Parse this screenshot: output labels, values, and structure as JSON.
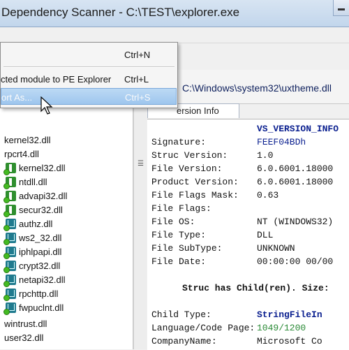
{
  "window": {
    "title": "Dependency Scanner - C:\\TEST\\explorer.exe"
  },
  "context_menu": {
    "items": [
      {
        "label": "",
        "shortcut": "Ctrl+N"
      },
      {
        "label": "cted module to PE Explorer",
        "shortcut": "Ctrl+L"
      },
      {
        "label": "ort As...",
        "shortcut": "Ctrl+S"
      }
    ]
  },
  "path_bar": {
    "path": "C:\\Windows\\system32\\uxtheme.dll"
  },
  "tab": {
    "label": "ersion Info"
  },
  "version_info": {
    "rows": [
      {
        "label": "",
        "value": "VS_VERSION_INFO"
      },
      {
        "label": "Signature:",
        "value": "FEEF04BDh"
      },
      {
        "label": "Struc Version:",
        "value": "1.0"
      },
      {
        "label": "File Version:",
        "value": "6.0.6001.18000"
      },
      {
        "label": "Product Version:",
        "value": "6.0.6001.18000"
      },
      {
        "label": "File Flags Mask:",
        "value": "0.63"
      },
      {
        "label": "File Flags:",
        "value": ""
      },
      {
        "label": "File OS:",
        "value": "NT (WINDOWS32)"
      },
      {
        "label": "File Type:",
        "value": "DLL"
      },
      {
        "label": "File SubType:",
        "value": "UNKNOWN"
      },
      {
        "label": "File Date:",
        "value": "00:00:00  00/00"
      }
    ],
    "struc_note": "Struc has Child(ren). Size:",
    "child_rows": [
      {
        "label": "Child Type:",
        "value": "StringFileIn"
      },
      {
        "label": "Language/Code Page:",
        "value": "1049/1200"
      },
      {
        "label": "CompanyName:",
        "value": "Microsoft Co"
      }
    ]
  },
  "tree": {
    "items": [
      {
        "label": "kernel32.dll",
        "icon": "none"
      },
      {
        "label": "rpcrt4.dll",
        "icon": "none"
      },
      {
        "label": "kernel32.dll",
        "icon": "green-dll-icon"
      },
      {
        "label": "ntdll.dll",
        "icon": "green-dll-icon"
      },
      {
        "label": "advapi32.dll",
        "icon": "green-dll-icon"
      },
      {
        "label": "secur32.dll",
        "icon": "green-dll-icon"
      },
      {
        "label": "authz.dll",
        "icon": "teal-dll-icon"
      },
      {
        "label": "ws2_32.dll",
        "icon": "teal-dll-icon"
      },
      {
        "label": "iphlpapi.dll",
        "icon": "teal-dll-icon"
      },
      {
        "label": "crypt32.dll",
        "icon": "teal-dll-icon"
      },
      {
        "label": "netapi32.dll",
        "icon": "teal-dll-icon"
      },
      {
        "label": "rpchttp.dll",
        "icon": "teal-dll-icon"
      },
      {
        "label": "fwpuclnt.dll",
        "icon": "teal-dll-icon"
      },
      {
        "label": "wintrust.dll",
        "icon": "none"
      },
      {
        "label": "user32.dll",
        "icon": "none"
      }
    ]
  },
  "colors": {
    "accent_blue": "#0a1f8f",
    "green_text": "#2a8a36",
    "menu_highlight": "#a9cdf0"
  }
}
